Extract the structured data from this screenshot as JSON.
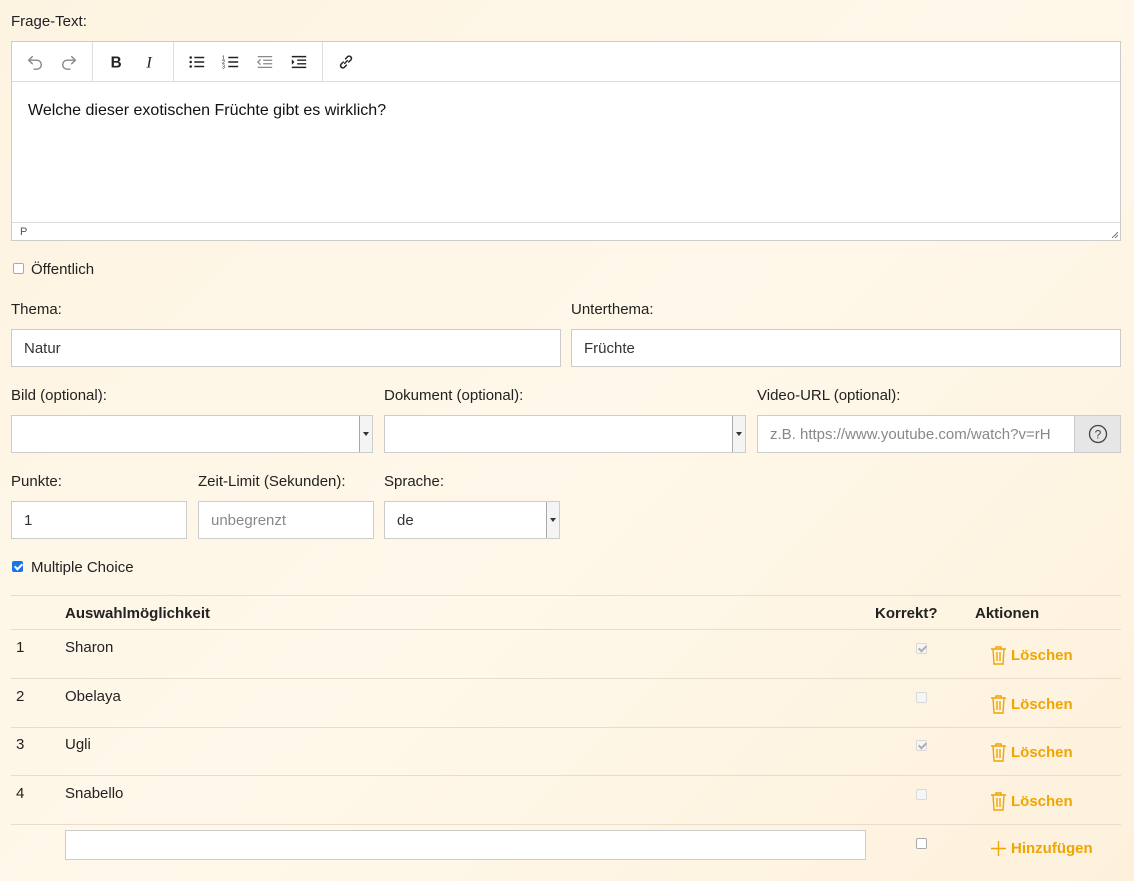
{
  "question": {
    "label": "Frage-Text:",
    "text": "Welche dieser exotischen Früchte gibt es wirklich?",
    "status_path": "P"
  },
  "public": {
    "label": "Öffentlich",
    "checked": false
  },
  "topic": {
    "label": "Thema:",
    "value": "Natur"
  },
  "subtopic": {
    "label": "Unterthema:",
    "value": "Früchte"
  },
  "image": {
    "label": "Bild (optional):",
    "value": ""
  },
  "document": {
    "label": "Dokument (optional):",
    "value": ""
  },
  "video": {
    "label": "Video-URL (optional):",
    "placeholder": "z.B. https://www.youtube.com/watch?v=rH"
  },
  "points": {
    "label": "Punkte:",
    "value": "1"
  },
  "time_limit": {
    "label": "Zeit-Limit (Sekunden):",
    "placeholder": "unbegrenzt"
  },
  "language": {
    "label": "Sprache:",
    "value": "de"
  },
  "multiple_choice": {
    "label": "Multiple Choice",
    "checked": true
  },
  "table": {
    "headers": {
      "option": "Auswahlmöglichkeit",
      "correct": "Korrekt?",
      "actions": "Aktionen"
    },
    "rows": [
      {
        "num": "1",
        "option": "Sharon",
        "correct": true,
        "action": "Löschen"
      },
      {
        "num": "2",
        "option": "Obelaya",
        "correct": false,
        "action": "Löschen"
      },
      {
        "num": "3",
        "option": "Ugli",
        "correct": true,
        "action": "Löschen"
      },
      {
        "num": "4",
        "option": "Snabello",
        "correct": false,
        "action": "Löschen"
      }
    ],
    "add_label": "Hinzufügen"
  },
  "colors": {
    "accent": "#f0a500",
    "checkbox": "#1a73e8"
  },
  "icons": [
    "undo-icon",
    "redo-icon",
    "bold-icon",
    "italic-icon",
    "bullet-list-icon",
    "numbered-list-icon",
    "outdent-icon",
    "indent-icon",
    "link-icon",
    "help-icon",
    "trash-icon",
    "plus-icon"
  ]
}
